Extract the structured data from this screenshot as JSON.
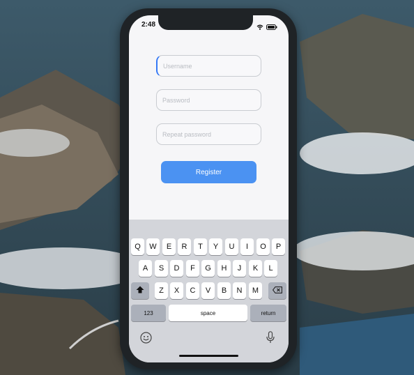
{
  "status_bar": {
    "time": "2:48",
    "icons": [
      "wifi-icon",
      "battery-icon"
    ]
  },
  "form": {
    "username": {
      "value": "",
      "placeholder": "Username"
    },
    "password": {
      "value": "",
      "placeholder": "Password"
    },
    "repeat_password": {
      "value": "",
      "placeholder": "Repeat password"
    },
    "register_label": "Register"
  },
  "keyboard": {
    "row1": [
      "Q",
      "W",
      "E",
      "R",
      "T",
      "Y",
      "U",
      "I",
      "O",
      "P"
    ],
    "row2": [
      "A",
      "S",
      "D",
      "F",
      "G",
      "H",
      "J",
      "K",
      "L"
    ],
    "row3": [
      "Z",
      "X",
      "C",
      "V",
      "B",
      "N",
      "M"
    ],
    "numbers_label": "123",
    "space_label": "space",
    "return_label": "return",
    "icons": [
      "shift-icon",
      "delete-icon",
      "emoji-icon",
      "microphone-icon"
    ]
  },
  "colors": {
    "accent": "#4b92f2",
    "screen_bg": "#f6f6f8",
    "keyboard_bg": "#d3d5da",
    "phone_frame": "#1f2326"
  }
}
